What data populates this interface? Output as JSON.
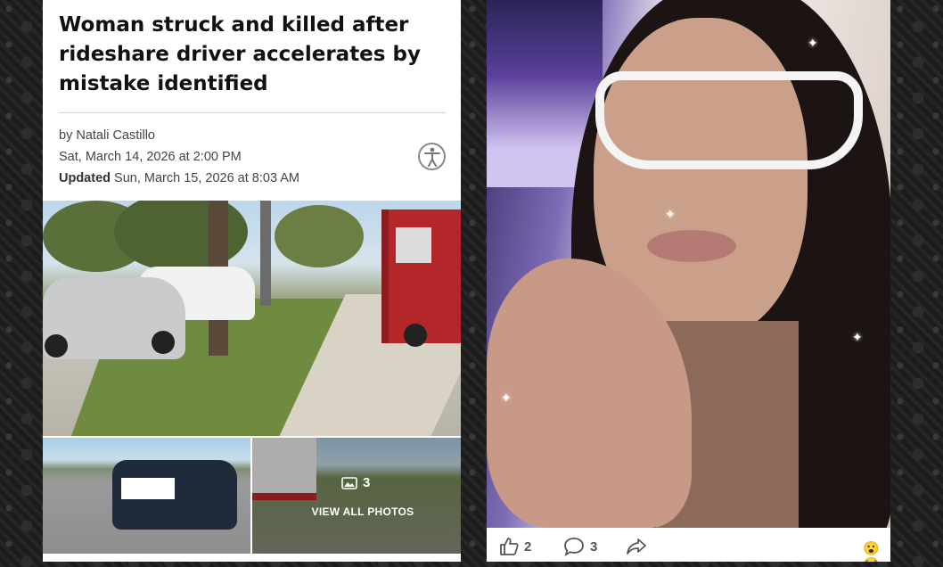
{
  "article": {
    "headline": "Woman struck and killed after rideshare driver accelerates by mistake identified",
    "byline": "by Natali Castillo",
    "published": "Sat, March 14, 2026 at 2:00 PM",
    "updated_label": "Updated",
    "updated": "Sun, March 15, 2026 at 8:03 AM",
    "accessibility_icon": "accessibility-icon",
    "photo_count": "3",
    "photo_count_icon": "gallery-icon",
    "view_all_label": "VIEW ALL PHOTOS"
  },
  "post": {
    "like_count": "2",
    "comment_count": "3",
    "like_icon": "thumbs-up-icon",
    "comment_icon": "comment-bubble-icon",
    "share_icon": "share-arrow-icon",
    "reaction_emoji": "😮😂"
  },
  "colors": {
    "headline": "#111111",
    "meta": "#444444",
    "firetruck_red": "#b3262a"
  }
}
